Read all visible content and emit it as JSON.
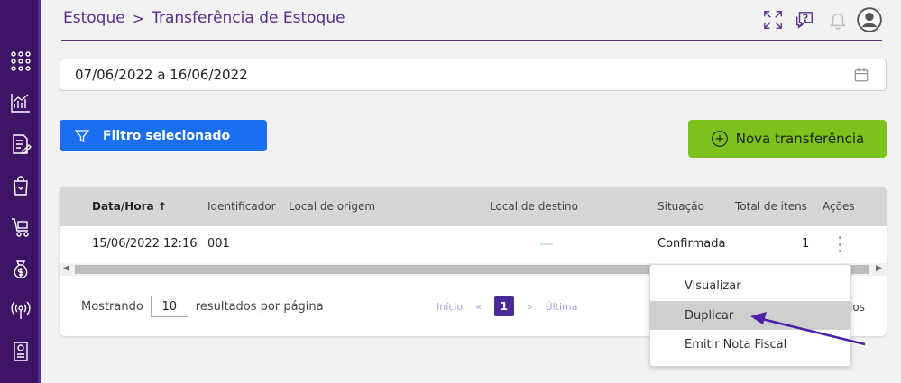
{
  "breadcrumb": {
    "root": "Estoque",
    "separator": ">",
    "current": "Transferência de Estoque"
  },
  "sidebar": {
    "items": [
      "apps-icon",
      "chart-icon",
      "document-edit-icon",
      "shopping-bag-icon",
      "cart-icon",
      "money-bag-icon",
      "broadcast-icon",
      "invoice-icon"
    ]
  },
  "header_icons": [
    "fullscreen-icon",
    "help-chat-icon",
    "bell-icon",
    "user-avatar-icon"
  ],
  "filters": {
    "date_range": "07/06/2022 a 16/06/2022",
    "filter_button": "Filtro selecionado",
    "new_button": "Nova transferência"
  },
  "table": {
    "columns": [
      "Data/Hora",
      "Identificador",
      "Local de origem",
      "Local de destino",
      "Situação",
      "Total de itens",
      "Ações"
    ],
    "sort_indicator": "↑",
    "rows": [
      {
        "datetime": "15/06/2022 12:16",
        "id": "001",
        "origin": "",
        "destination": "",
        "status": "Confirmada",
        "total": "1"
      }
    ]
  },
  "pagination": {
    "showing_label": "Mostrando",
    "per_page": "10",
    "per_page_suffix": "resultados por página",
    "first": "Início",
    "prev": "«",
    "current": "1",
    "next": "»",
    "last": "Última",
    "tail_text": "los"
  },
  "context_menu": {
    "items": [
      "Visualizar",
      "Duplicar",
      "Emitir Nota Fiscal"
    ],
    "highlighted": "Duplicar"
  },
  "colors": {
    "sidebar": "#3e1466",
    "brand_purple": "#5a2d8e",
    "filter_blue": "#1a6ef0",
    "new_green": "#7dc11d",
    "page_active": "#4b2a9c",
    "annotation_arrow": "#4b1fa8"
  }
}
